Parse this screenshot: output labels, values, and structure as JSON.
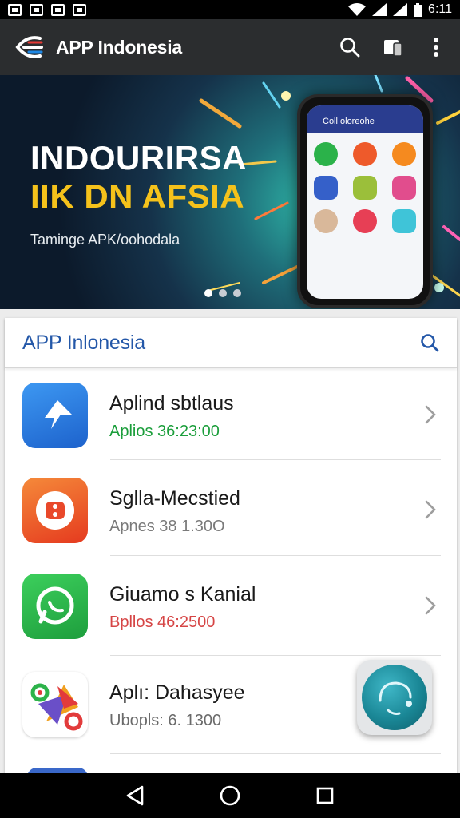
{
  "status_bar": {
    "time": "6:11",
    "icons": [
      "gallery-icon",
      "photo-icon",
      "check-icon",
      "play-store-icon",
      "wifi-icon",
      "signal-icon",
      "signal-icon",
      "battery-icon"
    ]
  },
  "toolbar": {
    "title": "APP Indonesia",
    "icons": [
      "app-logo-icon",
      "search-icon",
      "layers-icon",
      "more-vert-icon"
    ]
  },
  "banner": {
    "headline_1": "INDOURIRSA",
    "headline_2": "IIK DN AFSIA",
    "tagline": "Taminge APK/oohodala",
    "phone_screen_title": "Coll oloreohe",
    "carousel_pages": 3,
    "carousel_active": 1
  },
  "section": {
    "title": "APP Inlonesia",
    "search_icon": "search-icon"
  },
  "apps": [
    {
      "name": "Aplind sbtlaus",
      "sub": "Aplios 36:23:00",
      "sub_color": "#1b9e3b",
      "icon_color": "#2a7fe0"
    },
    {
      "name": "Sglla-Mecstied",
      "sub": "Apnes 38 1.30O",
      "sub_color": "#7a7a7a",
      "icon_color": "#f0572a"
    },
    {
      "name": "Giuamo s Kanial",
      "sub": "Bpllos 46:2500",
      "sub_color": "#d64545",
      "icon_color": "#25b24a"
    },
    {
      "name": "Aplı: Dahasyee",
      "sub": "Ubopls: 6. 1300",
      "sub_color": "#6a6a6a",
      "icon_color": "#ffffff"
    }
  ],
  "nav": {
    "icons": [
      "back-icon",
      "home-icon",
      "recents-icon"
    ]
  }
}
